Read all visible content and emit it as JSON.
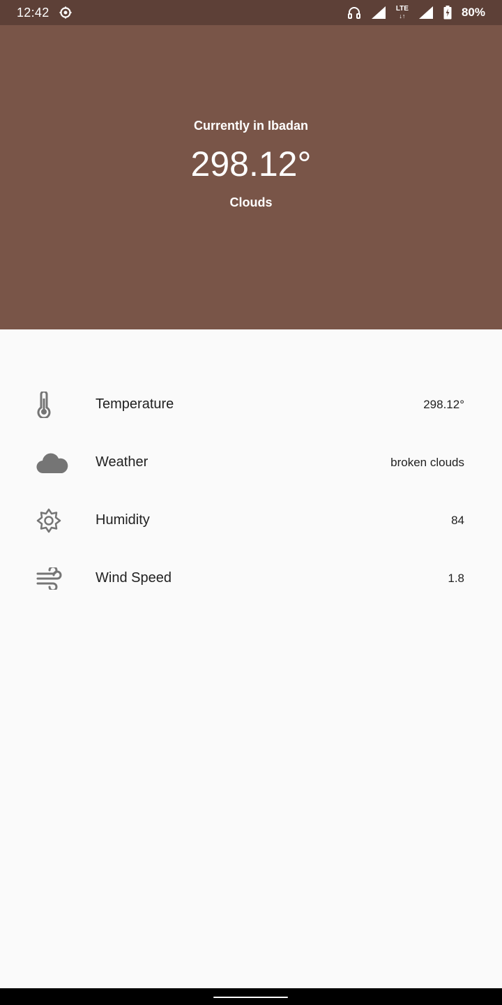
{
  "status_bar": {
    "time": "12:42",
    "battery": "80%",
    "network": "LTE"
  },
  "header": {
    "location": "Currently in Ibadan",
    "temperature": "298.12°",
    "condition": "Clouds",
    "color": "#795548"
  },
  "details": [
    {
      "icon": "thermometer-icon",
      "label": "Temperature",
      "value": "298.12°"
    },
    {
      "icon": "cloud-icon",
      "label": "Weather",
      "value": "broken clouds"
    },
    {
      "icon": "sun-icon",
      "label": "Humidity",
      "value": "84"
    },
    {
      "icon": "wind-icon",
      "label": "Wind Speed",
      "value": "1.8"
    }
  ]
}
